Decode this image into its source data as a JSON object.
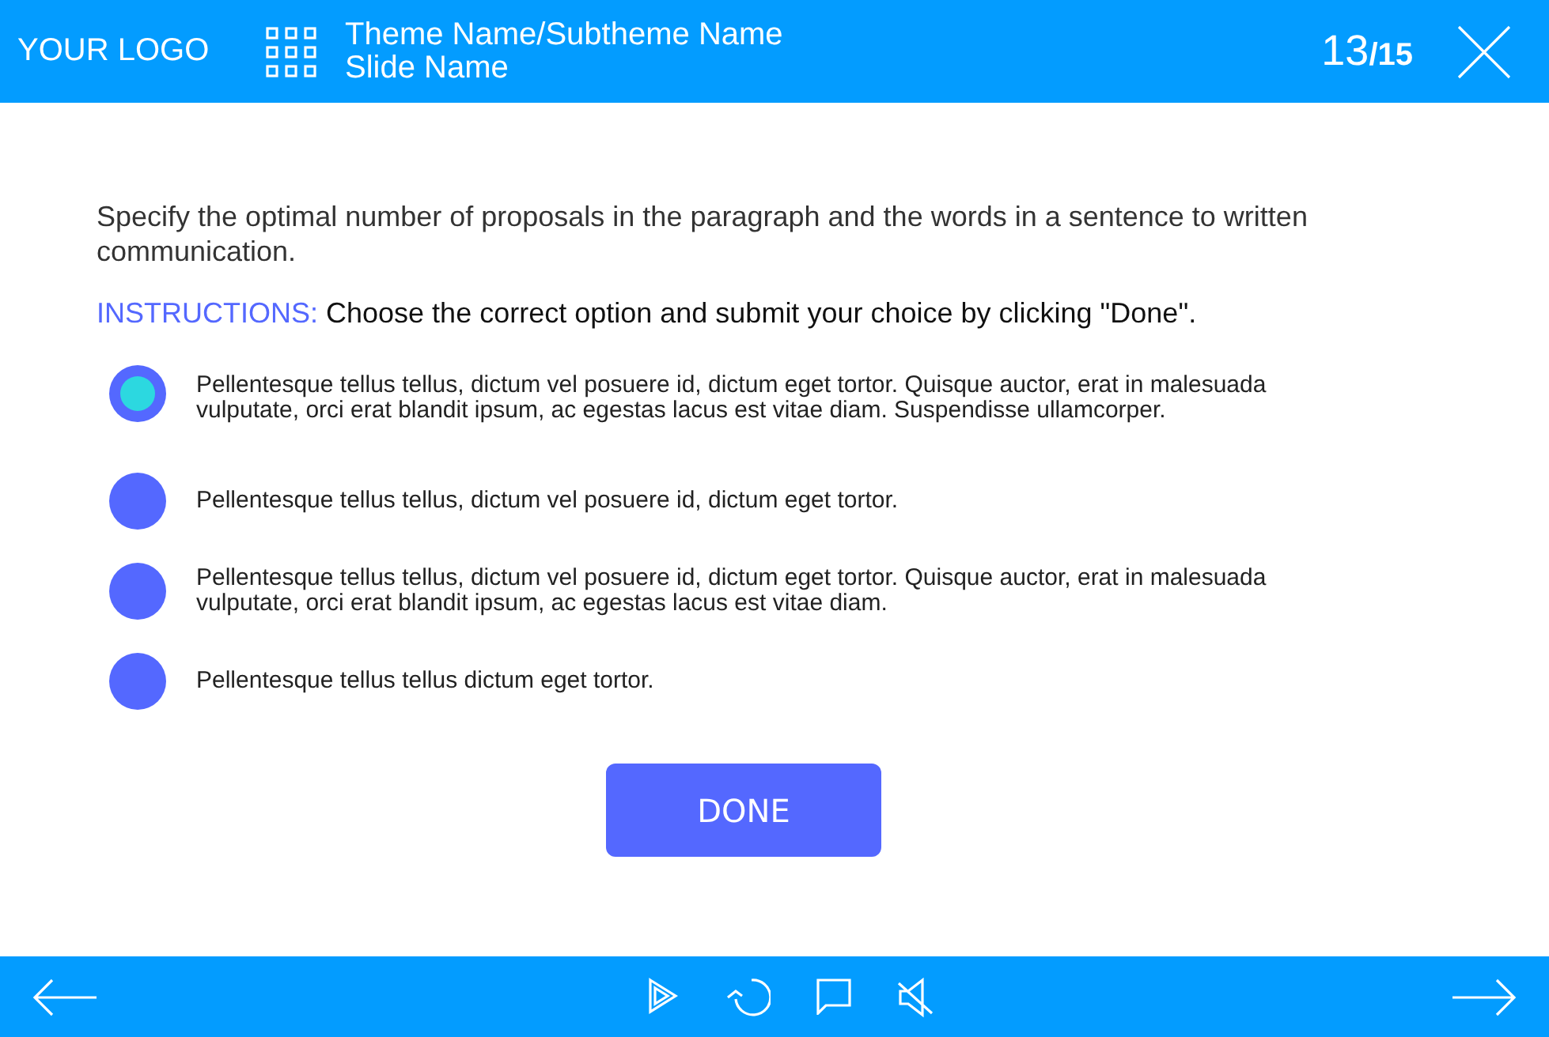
{
  "header": {
    "logo": "YOUR LOGO",
    "theme": "Theme Name/Subtheme Name",
    "slide": "Slide Name",
    "current": "13",
    "total": "/15"
  },
  "question": "Specify the optimal number of proposals in the paragraph and the words in a sentence to written communication.",
  "instructions": {
    "label": "INSTRUCTIONS:",
    "text": "Choose the correct option and submit your choice by clicking \"Done\"."
  },
  "options": [
    {
      "text": "Pellentesque tellus tellus, dictum vel posuere id, dictum eget tortor. Quisque auctor, erat in malesuada vulputate, orci erat blandit ipsum, ac egestas lacus est vitae diam. Suspendisse ullamcorper.",
      "selected": true
    },
    {
      "text": "Pellentesque tellus tellus, dictum vel posuere id, dictum eget tortor.",
      "selected": false
    },
    {
      "text": "Pellentesque tellus tellus, dictum vel posuere id, dictum eget tortor. Quisque auctor, erat in malesuada vulputate, orci erat blandit ipsum, ac egestas lacus est vitae diam.",
      "selected": false
    },
    {
      "text": "Pellentesque tellus tellus dictum eget tortor.",
      "selected": false
    }
  ],
  "done_button": "DONE"
}
